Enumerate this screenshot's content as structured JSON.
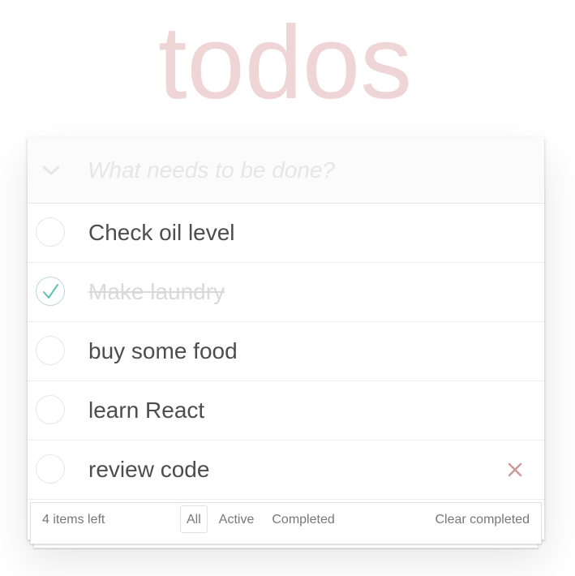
{
  "header": {
    "title": "todos",
    "new_todo_placeholder": "What needs to be done?"
  },
  "todos": [
    {
      "label": "Check oil level",
      "completed": false
    },
    {
      "label": "Make laundry",
      "completed": true
    },
    {
      "label": "buy some food",
      "completed": false
    },
    {
      "label": "learn React",
      "completed": false
    },
    {
      "label": "review code",
      "completed": false,
      "hovered": true
    }
  ],
  "footer": {
    "items_left": "4 items left",
    "filters": [
      "All",
      "Active",
      "Completed"
    ],
    "selected_filter": "All",
    "clear_completed": "Clear completed"
  },
  "icons": {
    "toggle_all": "chevron-down-icon",
    "check": "checkmark-icon",
    "destroy": "close-icon"
  },
  "colors": {
    "title": "#efd5d5",
    "check_mark": "#5dc2af",
    "destroy": "#cc9a9a",
    "text": "#4d4d4d",
    "completed_text": "#d9d9d9"
  }
}
